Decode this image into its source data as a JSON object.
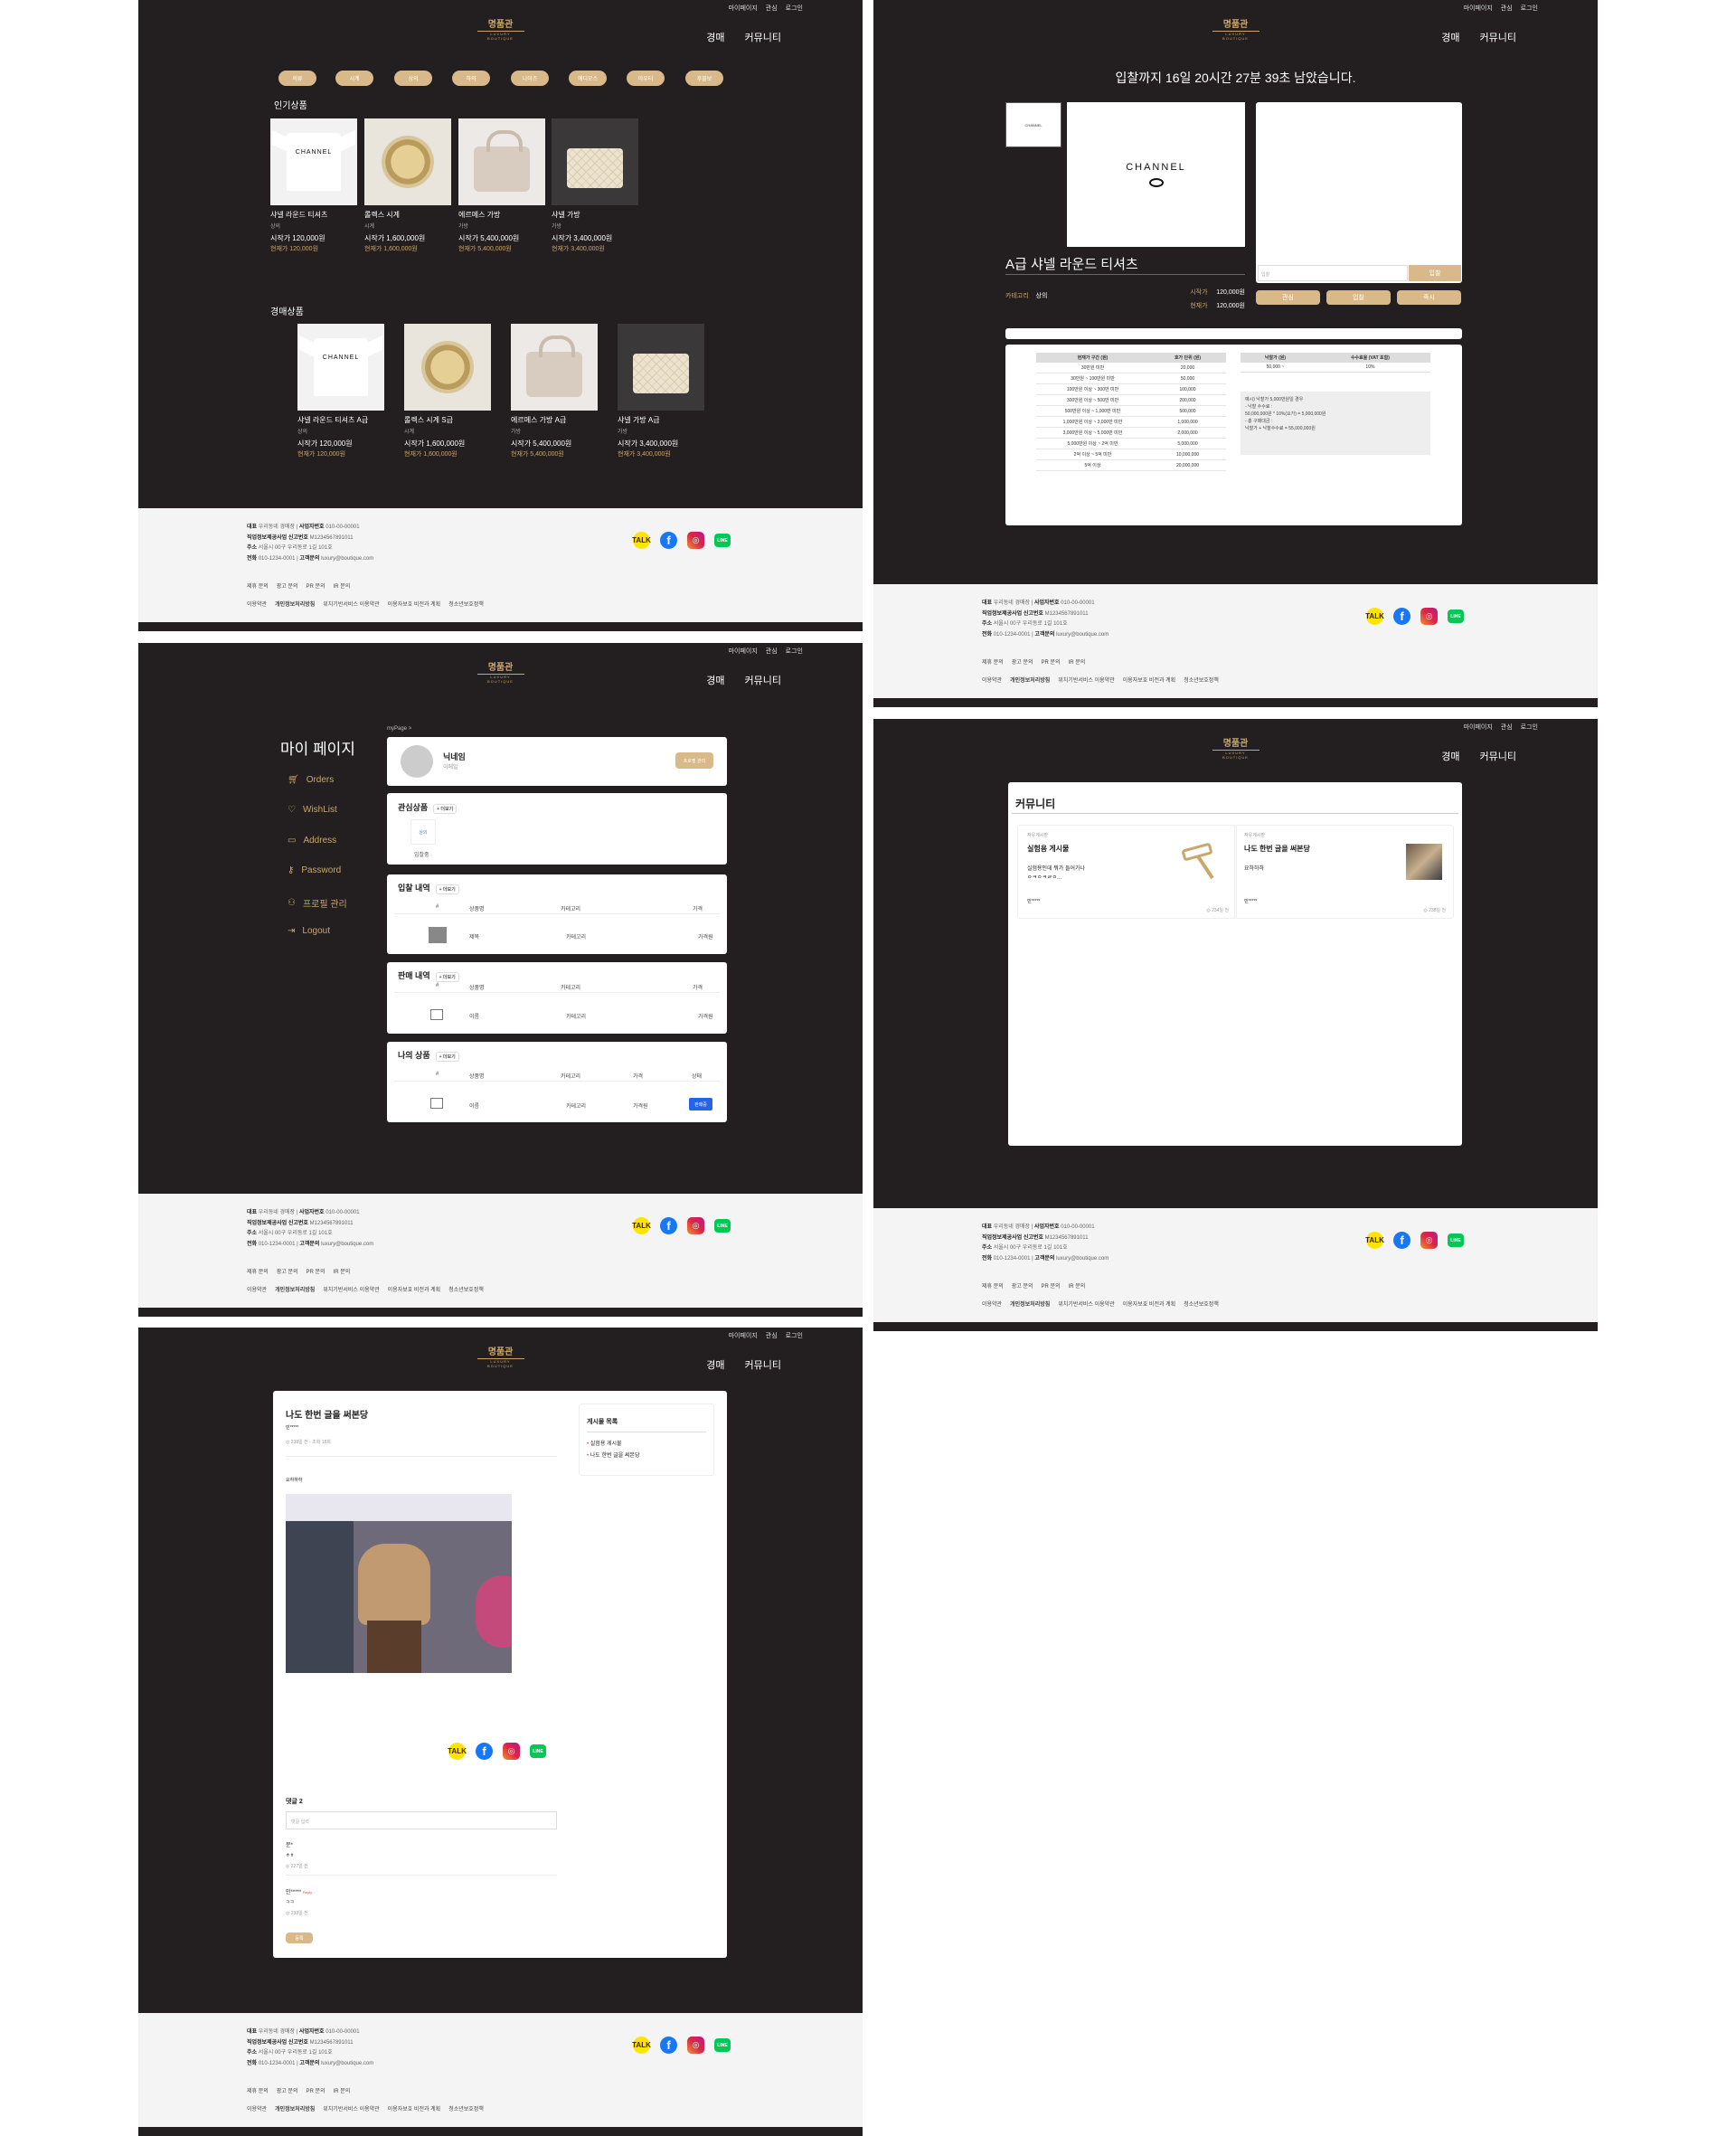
{
  "common": {
    "logo_title": "명품관",
    "logo_sub": "LUXURY BOUTIQUE",
    "top_nav": [
      "마이페이지",
      "관심",
      "로그인"
    ],
    "main_nav": [
      "경매",
      "커뮤니티"
    ],
    "footer": {
      "ceo_label": "대표",
      "ceo": "우리동네 경매장",
      "biz_label": "사업자번호",
      "biz": "010-00-00001",
      "mail_label": "직업정보제공사업 신고번호",
      "mail": "M1234567891011",
      "addr_label": "주소",
      "addr": "서울시 00구 우리동로 1길 101호",
      "tel_label": "전화",
      "tel": "010-1234-0001",
      "email_label": "고객문의",
      "email": "luxury@boutique.com",
      "links1": [
        "제휴 문의",
        "광고 문의",
        "PR 문의",
        "IR 문의"
      ],
      "links2": [
        "이용약관",
        "개인정보처리방침",
        "위치기반서비스 이용약관",
        "이용자보호 비전과 계획",
        "청소년보호정책"
      ],
      "social": {
        "kakao": "TALK",
        "facebook": "f",
        "instagram": "◎",
        "line": "LINE"
      }
    }
  },
  "home": {
    "categories": [
      "의류",
      "시계",
      "상의",
      "하의",
      "나이즈",
      "에디오스",
      "아우터",
      "후불보"
    ],
    "popular_title": "인기상품",
    "auction_title": "경매상품",
    "popular": [
      {
        "name": "샤넬 라운드 티셔츠",
        "cat": "상의",
        "start": "시작가 120,000원",
        "cur": "현재가 120,000원"
      },
      {
        "name": "롤렉스 시계",
        "cat": "시계",
        "start": "시작가 1,600,000원",
        "cur": "현재가 1,600,000원"
      },
      {
        "name": "에르메스 가방",
        "cat": "가방",
        "start": "시작가 5,400,000원",
        "cur": "현재가 5,400,000원"
      },
      {
        "name": "샤넬 가방",
        "cat": "가방",
        "start": "시작가 3,400,000원",
        "cur": "현재가 3,400,000원"
      }
    ],
    "auction": [
      {
        "name": "샤넬 라운드 티셔츠 A급",
        "cat": "상의",
        "start": "시작가 120,000원",
        "cur": "현재가 120,000원"
      },
      {
        "name": "롤렉스 시계 S급",
        "cat": "시계",
        "start": "시작가 1,600,000원",
        "cur": "현재가 1,600,000원"
      },
      {
        "name": "에르메스 가방 A급",
        "cat": "가방",
        "start": "시작가 5,400,000원",
        "cur": "현재가 5,400,000원"
      },
      {
        "name": "샤넬 가방 A급",
        "cat": "가방",
        "start": "시작가 3,400,000원",
        "cur": "현재가 3,400,000원"
      }
    ]
  },
  "detail": {
    "countdown": "입찰까지 16일 20시간 27분 39초 남았습니다.",
    "brand_print": "CHANNEL",
    "title": "A급 샤넬 라운드 티셔츠",
    "cat_label": "카테고리",
    "cat": "상의",
    "start_label": "시작가",
    "start": "120,000원",
    "cur_label": "현재가",
    "cur": "120,000원",
    "bid_placeholder": "입찰",
    "bid_btn": "입찰",
    "actions": [
      "관심",
      "입찰",
      "즉시"
    ],
    "increment_headers": [
      "현재가 구간 (원)",
      "호가 단위 (원)"
    ],
    "increments": [
      [
        "30만원 미만",
        "20,000"
      ],
      [
        "30만원 ~ 100만원 미만",
        "50,000"
      ],
      [
        "100만원 이상 ~ 300만 미만",
        "100,000"
      ],
      [
        "300만원 이상 ~ 500만 미만",
        "200,000"
      ],
      [
        "500만원 이상 ~ 1,000만 미만",
        "500,000"
      ],
      [
        "1,000만원 이상 ~ 3,000만 미만",
        "1,000,000"
      ],
      [
        "3,000만원 이상 ~ 5,000만 미만",
        "2,000,000"
      ],
      [
        "5,000만원 이상 ~ 2억 미만",
        "5,000,000"
      ],
      [
        "2억 이상 ~ 5억 미만",
        "10,000,000"
      ],
      [
        "5억 이상",
        "20,000,000"
      ]
    ],
    "fee_headers": [
      "낙찰가 (원)",
      "수수료율 (VAT 포함)"
    ],
    "fee_row": [
      "50,000 ~",
      "10%"
    ],
    "fee_note": [
      "예시) 낙찰가 5,000만원일 경우",
      "- 낙찰 수수료 :",
      "50,000,000원 * 10%(요가) = 5,000,000원",
      "- 총 구매대금 :",
      "낙찰가 + 낙찰수수료 = 55,000,000원"
    ]
  },
  "mypage": {
    "title": "마이 페이지",
    "menu": [
      "Orders",
      "WishList",
      "Address",
      "Password",
      "프로필 관리",
      "Logout"
    ],
    "crumb": "myPage  >",
    "nickname": "닉네임",
    "name": "이메일",
    "profile_btn": "프로필 관리",
    "wish_title": "관심상품",
    "more": "+ 더보기",
    "wish_item_tag": "상의",
    "wish_item": "입찰중",
    "bid_title": "입찰 내역",
    "sell_title": "판매 내역",
    "my_title": "나의 상품",
    "col_no": "#",
    "col_name": "상품명",
    "col_cat": "카테고리",
    "col_price": "가격",
    "col_status": "상태",
    "row_name1": "제목",
    "row_name2": "이름",
    "row_cat": "카테고리",
    "row_price": "가격원",
    "row_btn": "판매중"
  },
  "community": {
    "title": "커뮤니티",
    "posts": [
      {
        "board": "자유게시판",
        "title": "실험용 게시물",
        "body": "실험용인데 뭐가 들어가나",
        "body2": "ㅇㅋㅇㅋㄹㅇ...",
        "author": "민*****",
        "meta": "◎ 234일 전"
      },
      {
        "board": "자유게시판",
        "title": "나도 한번 글을 써본당",
        "body": "요하하하",
        "author": "민*****",
        "meta": "◎ 238일 전"
      }
    ]
  },
  "post": {
    "title": "나도 한번 글을 써본당",
    "author": "민*****",
    "meta": "◎ 238일 전 · 조회 18회",
    "body": "요하하하",
    "side_title": "게시물 목록",
    "side_items": [
      "실험용 게시물",
      "나도 한번 글을 써본당"
    ],
    "comment_title": "댓글 2",
    "comment_placeholder": "댓글 입력",
    "comments": [
      {
        "user": "문*",
        "text": "ㅎㅎ",
        "meta": "◎ 227일 전",
        "badge": ""
      },
      {
        "user": "민*****",
        "text": "ㅋㅋ",
        "meta": "◎ 238일 전",
        "badge": "Reply"
      }
    ],
    "submit": "등록"
  }
}
